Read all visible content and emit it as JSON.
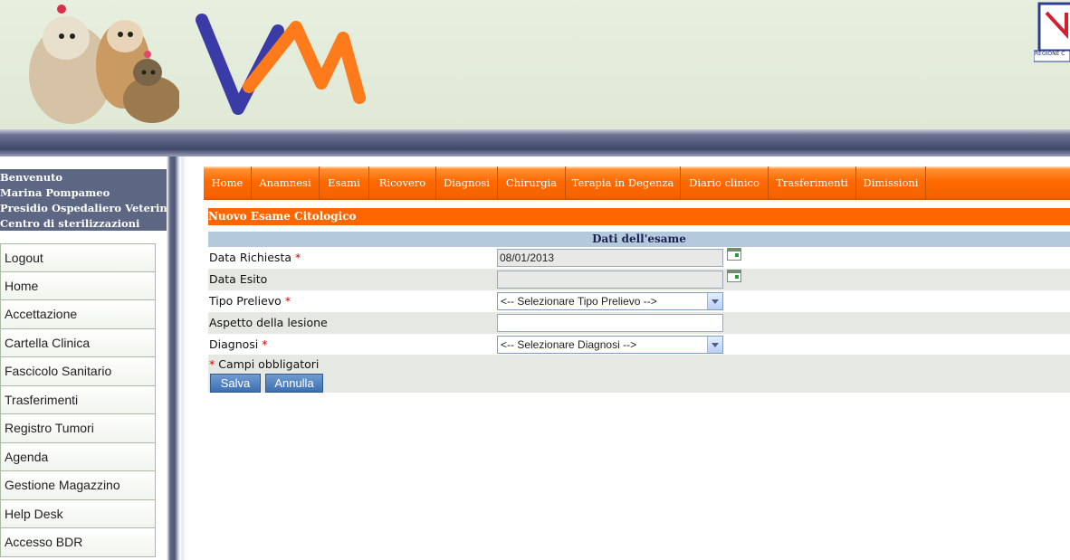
{
  "header": {
    "region_label": "REGIONE C"
  },
  "sidebar": {
    "welcome": [
      "Benvenuto",
      "Marina Pompameo",
      "Presidio Ospedaliero Veterinario",
      "Centro di sterilizzazioni"
    ],
    "items": [
      {
        "label": "Logout"
      },
      {
        "label": "Home"
      },
      {
        "label": "Accettazione"
      },
      {
        "label": "Cartella Clinica"
      },
      {
        "label": "Fascicolo Sanitario"
      },
      {
        "label": "Trasferimenti"
      },
      {
        "label": "Registro Tumori"
      },
      {
        "label": "Agenda"
      },
      {
        "label": "Gestione Magazzino"
      },
      {
        "label": "Help Desk"
      },
      {
        "label": "Accesso BDR"
      }
    ]
  },
  "menu": {
    "tabs": [
      "Home",
      "Anamnesi",
      "Esami",
      "Ricovero",
      "Diagnosi",
      "Chirurgia",
      "Terapia in Degenza",
      "Diario clinico",
      "Trasferimenti",
      "Dimissioni"
    ]
  },
  "form": {
    "title": "Nuovo Esame Citologico",
    "section": "Dati dell'esame",
    "required_mark": "*",
    "fields": {
      "data_richiesta": {
        "label": "Data Richiesta",
        "value": "08/01/2013"
      },
      "data_esito": {
        "label": "Data Esito",
        "value": ""
      },
      "tipo_prelievo": {
        "label": "Tipo Prelievo",
        "selected": "<-- Selezionare Tipo Prelievo -->"
      },
      "aspetto_lesione": {
        "label": "Aspetto della lesione",
        "value": ""
      },
      "diagnosi": {
        "label": "Diagnosi",
        "selected": "<-- Selezionare Diagnosi -->"
      }
    },
    "required_note": "Campi obbligatori",
    "buttons": {
      "save": "Salva",
      "cancel": "Annulla"
    }
  },
  "colors": {
    "accent_orange": "#ff6600",
    "sidebar_dark": "#5d6683",
    "section_header": "#b5c9dd",
    "button_blue": "#3d6fb0",
    "logo_blue": "#3b3ba8",
    "logo_orange": "#ff7a1a"
  }
}
